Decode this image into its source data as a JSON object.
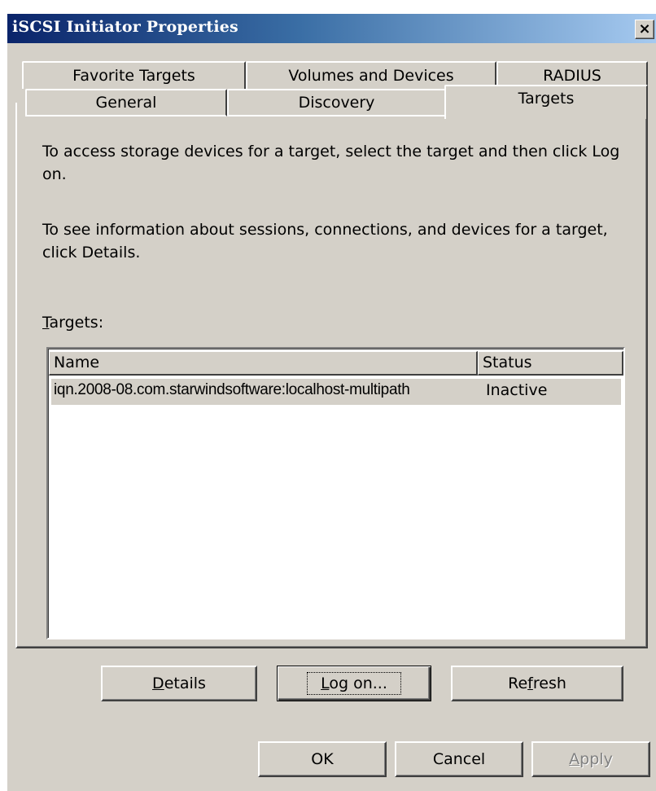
{
  "window": {
    "title": "iSCSI Initiator Properties",
    "close_label": "×"
  },
  "tabs": {
    "row_back": [
      {
        "label": "Favorite Targets"
      },
      {
        "label": "Volumes and Devices"
      },
      {
        "label": "RADIUS"
      }
    ],
    "row_front": [
      {
        "label": "General"
      },
      {
        "label": "Discovery"
      },
      {
        "label": "Targets",
        "selected": true
      }
    ]
  },
  "targets_page": {
    "instruction_1": "To access storage devices for a target, select the target and then click Log on.",
    "instruction_2": "To see information about sessions, connections, and devices for a target, click Details.",
    "list_label_prefix": "T",
    "list_label_rest": "argets:",
    "columns": [
      "Name",
      "Status"
    ],
    "rows": [
      {
        "name": "iqn.2008-08.com.starwindsoftware:localhost-multipath",
        "status": "Inactive",
        "selected": true
      }
    ],
    "buttons": {
      "details_accel": "D",
      "details_rest": "etails",
      "logon_accel": "L",
      "logon_rest": "og on...",
      "refresh_pre": "Re",
      "refresh_accel": "f",
      "refresh_rest": "resh"
    }
  },
  "dialog_buttons": {
    "ok": "OK",
    "cancel": "Cancel",
    "apply_accel": "A",
    "apply_rest": "pply"
  },
  "colors": {
    "face": "#d4d0c8",
    "title_start": "#0a246a",
    "title_end": "#a6caf0"
  }
}
